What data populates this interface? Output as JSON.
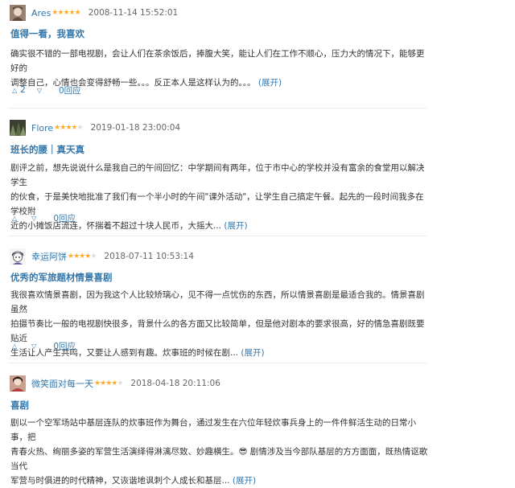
{
  "reviews": [
    {
      "author": "Ares",
      "rating": 5,
      "time": "2008-11-14 15:52:01",
      "title": "值得一看，我喜欢",
      "lines": [
        "确实很不错的一部电视剧，会让人们在茶余饭后，捧腹大笑，能让人们在工作不顺心，压力大的情况下，能够更好的",
        "调整自己，心情也会变得舒畅一些。。。反正本人是这样认为的。。。"
      ],
      "expand": "(展开)",
      "up_count": "2",
      "reply": "0回应"
    },
    {
      "author": "Flore",
      "rating": 4,
      "time": "2019-01-18 23:00:04",
      "title": "班长的腰｜真天真",
      "lines": [
        "剧评之前，想先说说什么是我自己的午间回忆：中学期间有两年，位于市中心的学校并没有富余的食堂用以解决学生",
        "的伙食，于是美快地批准了我们有一个半小时的午间\"课外活动\"，让学生自己搞定午餐。起先的一段时间我多在学校附",
        "近的小摊饭店流连，怀揣着不超过十块人民币，大摇大..."
      ],
      "expand": "(展开)",
      "up_count": "",
      "reply": "0回应"
    },
    {
      "author": "幸运阿饼",
      "rating": 4,
      "time": "2018-07-11 10:53:14",
      "title": "优秀的军旅题材情景喜剧",
      "lines": [
        "我很喜欢情景喜剧，因为我这个人比较矫璃心，见不得一点忧伤的东西，所以情景喜剧是最适合我的。情景喜剧虽然",
        "拍摄节奏比一般的电视剧快很多，背景什么的各方面又比较简单，但是他对剧本的要求很高，好的情急喜剧既要贴近",
        "生活让人产生共鸣，又要让人感到有趣。炊事班的时候在剧..."
      ],
      "expand": "(展开)",
      "up_count": "",
      "reply": "0回应"
    },
    {
      "author": "微笑面对每一天",
      "rating": 4,
      "time": "2018-04-18 20:11:06",
      "title": "喜剧",
      "lines": [
        "剧以一个空军场站中基层连队的炊事班作为舞台，通过发生在六位年轻炊事兵身上的一件件鲜活生动的日常小事，把",
        "青春火热、绚丽多姿的军营生活演绎得淋漓尽致、妙趣横生。😎 剧情涉及当今部队基层的方方面面，既热情讴歌当代",
        "军营与时俱进的时代精神，又诙谐地讽刺个人成长和基层..."
      ],
      "expand": "(展开)",
      "up_count": "",
      "reply": ""
    }
  ],
  "colors": {
    "link": "#3377aa",
    "star": "#ffac2d",
    "text": "#333333",
    "meta": "#666666"
  },
  "icons": {
    "up": "triangle-up-icon",
    "down": "triangle-down-icon"
  }
}
